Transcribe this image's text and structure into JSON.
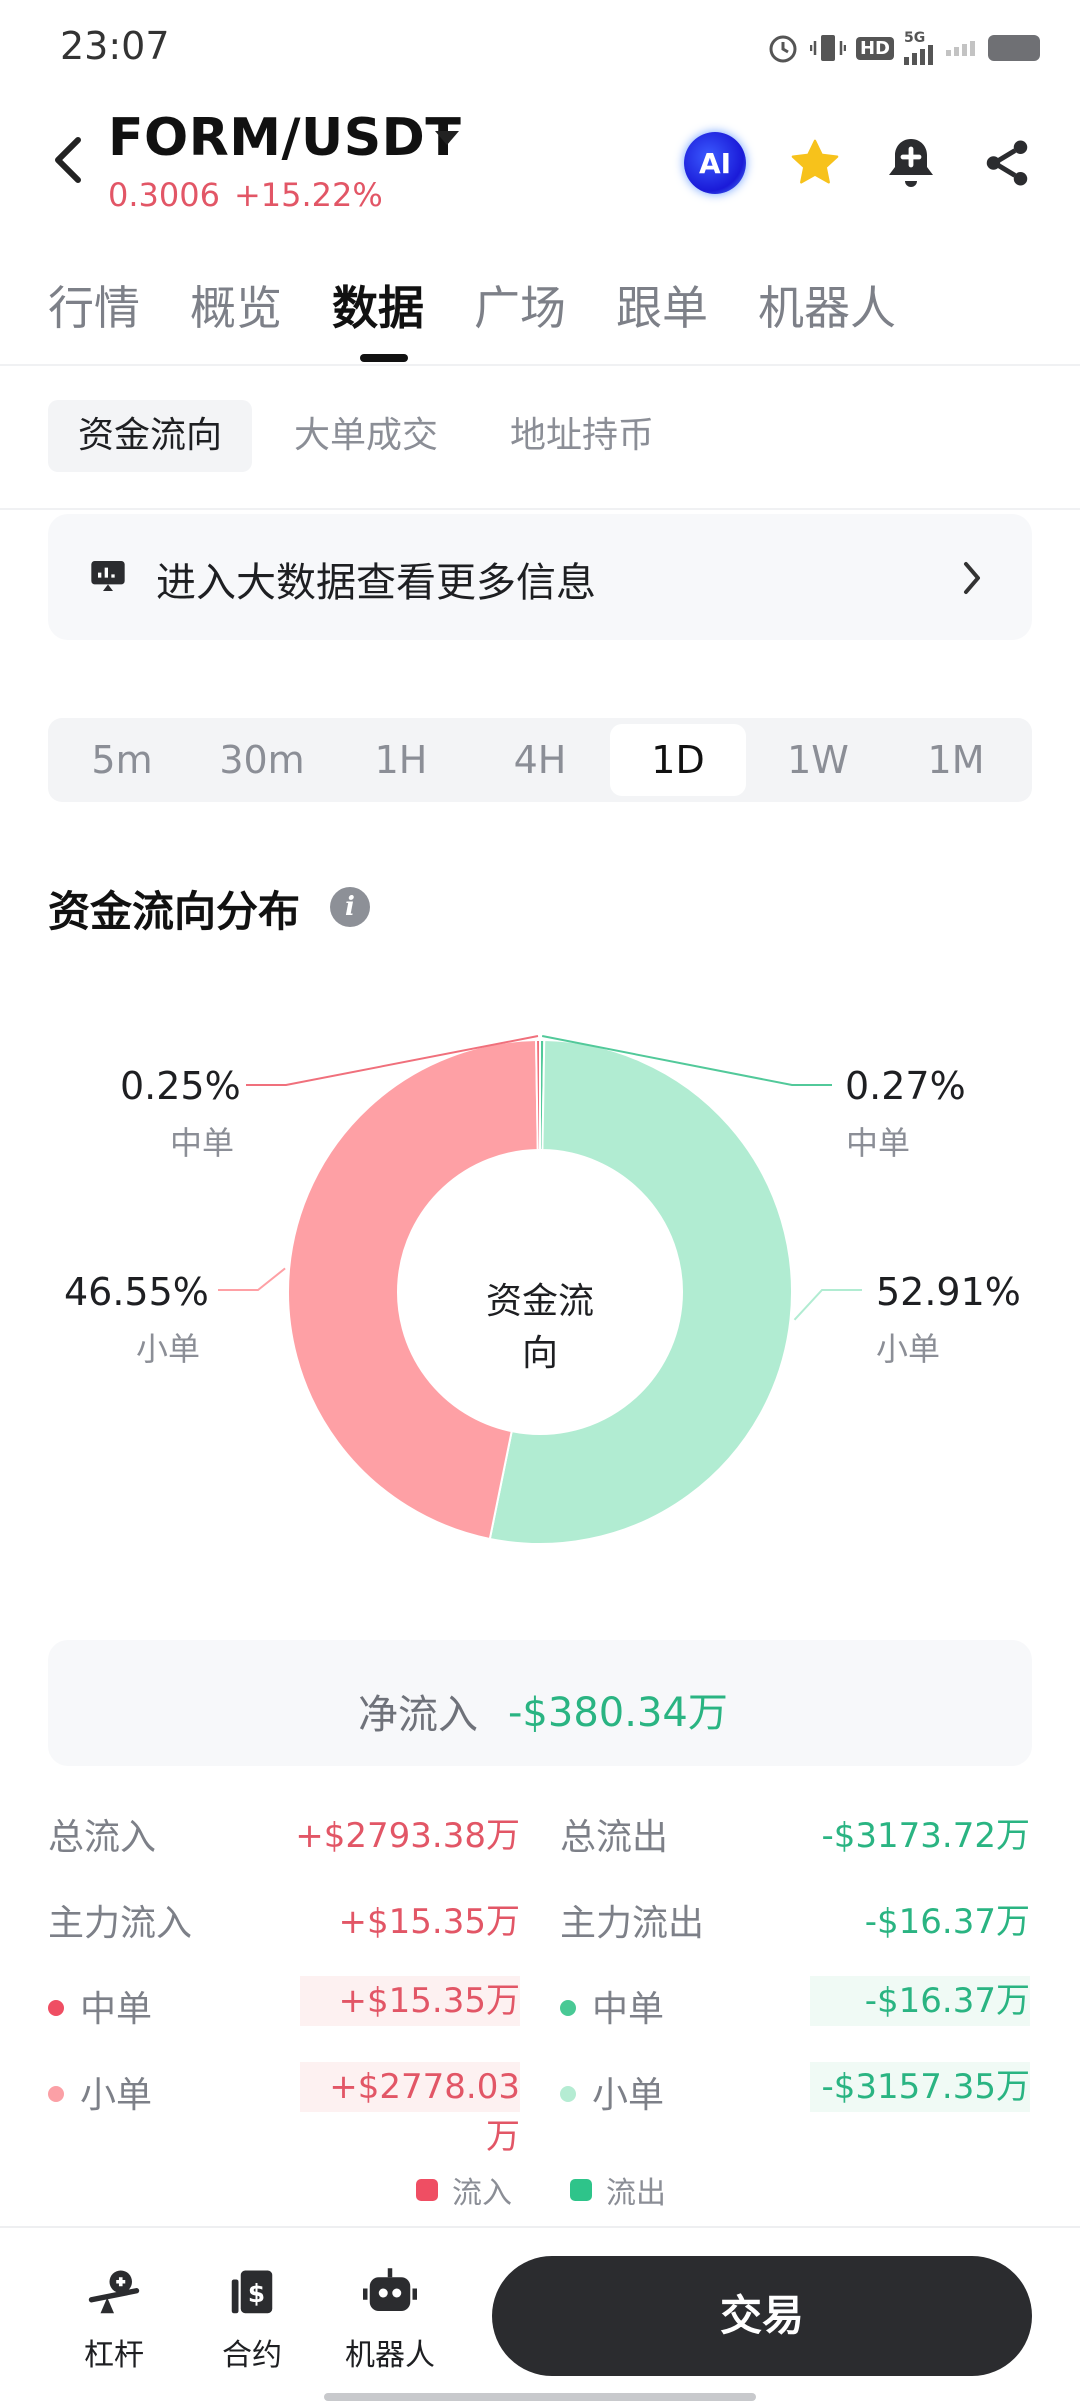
{
  "status_bar": {
    "time": "23:07",
    "icons": [
      "alarm-icon",
      "vibrate-icon",
      "hd-icon",
      "5g-signal-icon",
      "wifi-signal-icon",
      "battery-icon"
    ],
    "hd_label": "HD",
    "net_label": "5G"
  },
  "header": {
    "pair": "FORM/USDT",
    "price": "0.3006",
    "change": "+15.22%",
    "ai_label": "AI",
    "icons": [
      "back-icon",
      "dropdown-caret-icon",
      "ai-icon",
      "star-icon",
      "bell-add-icon",
      "share-icon"
    ]
  },
  "main_tabs": [
    "行情",
    "概览",
    "数据",
    "广场",
    "跟单",
    "机器人"
  ],
  "active_main_tab": "数据",
  "sub_tabs": [
    "资金流向",
    "大单成交",
    "地址持币"
  ],
  "active_sub_tab": "资金流向",
  "banner": {
    "text": "进入大数据查看更多信息"
  },
  "timeframes": [
    "5m",
    "30m",
    "1H",
    "4H",
    "1D",
    "1W",
    "1M"
  ],
  "active_timeframe": "1D",
  "section_title": "资金流向分布",
  "chart_data": {
    "type": "pie",
    "center_label": "资金流向",
    "slices": [
      {
        "label": "中单",
        "value": 0.27,
        "pct_text": "0.27%",
        "color": "#52c99a",
        "flow": "流出"
      },
      {
        "label": "小单",
        "value": 52.91,
        "pct_text": "52.91%",
        "color": "#b1ecd2",
        "flow": "流出"
      },
      {
        "label": "小单",
        "value": 46.55,
        "pct_text": "46.55%",
        "color": "#fea0a5",
        "flow": "流入"
      },
      {
        "label": "中单",
        "value": 0.25,
        "pct_text": "0.25%",
        "color": "#f0707c",
        "flow": "流入"
      }
    ]
  },
  "net_inflow": {
    "label": "净流入",
    "value": "-$380.34万"
  },
  "stats": {
    "total_in_label": "总流入",
    "total_in": "+$2793.38万",
    "total_out_label": "总流出",
    "total_out": "-$3173.72万",
    "main_in_label": "主力流入",
    "main_in": "+$15.35万",
    "main_out_label": "主力流出",
    "main_out": "-$16.37万",
    "mid_in_label": "中单",
    "mid_in": "+$15.35万",
    "mid_out_label": "中单",
    "mid_out": "-$16.37万",
    "small_in_label": "小单",
    "small_in": "+$2778.03万",
    "small_out_label": "小单",
    "small_out": "-$3157.35万"
  },
  "legend": {
    "in": "流入",
    "out": "流出",
    "in_color": "#ef4e63",
    "out_color": "#2ec48a"
  },
  "bottom_nav": {
    "items": [
      {
        "label": "杠杆",
        "icon": "leverage-icon"
      },
      {
        "label": "合约",
        "icon": "contract-icon"
      },
      {
        "label": "机器人",
        "icon": "robot-icon"
      }
    ],
    "trade_label": "交易"
  },
  "colors": {
    "up": "#e25666",
    "down": "#2ab482",
    "accent": "#1e1f22"
  }
}
